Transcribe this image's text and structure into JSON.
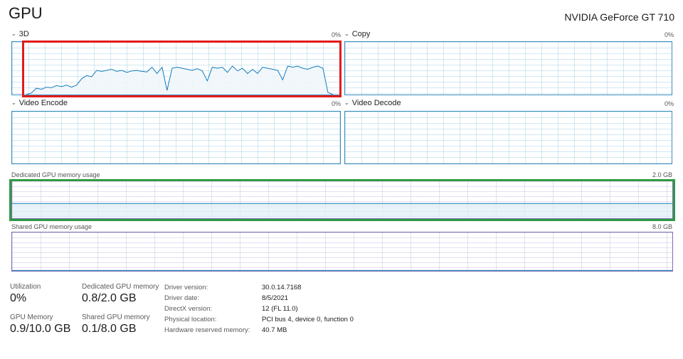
{
  "header": {
    "title": "GPU",
    "device": "NVIDIA GeForce GT 710"
  },
  "engines": [
    {
      "name": "3D",
      "percent": "0%",
      "samples": [
        0,
        3,
        12,
        10,
        14,
        13,
        17,
        15,
        18,
        14,
        18,
        30,
        36,
        34,
        46,
        44,
        46,
        48,
        44,
        46,
        42,
        45,
        46,
        44,
        43,
        52,
        40,
        52,
        8,
        50,
        52,
        50,
        48,
        46,
        49,
        45,
        26,
        52,
        50,
        52,
        42,
        54,
        45,
        50,
        40,
        48,
        40,
        52,
        50,
        48,
        46,
        28,
        54,
        52,
        54,
        50,
        48,
        52,
        54,
        50,
        4,
        0
      ]
    },
    {
      "name": "Copy",
      "percent": "0%",
      "samples": []
    },
    {
      "name": "Video Encode",
      "percent": "0%",
      "samples": []
    },
    {
      "name": "Video Decode",
      "percent": "0%",
      "samples": []
    }
  ],
  "dedicated_memory": {
    "label": "Dedicated GPU memory usage",
    "max": "2.0 GB",
    "fraction": 0.4
  },
  "shared_memory": {
    "label": "Shared GPU memory usage",
    "max": "8.0 GB",
    "fraction": 0.0125
  },
  "stats": {
    "utilization": {
      "label": "Utilization",
      "value": "0%"
    },
    "dedicated": {
      "label": "Dedicated GPU memory",
      "value": "0.8/2.0 GB"
    },
    "gpu_memory": {
      "label": "GPU Memory",
      "value": "0.9/10.0 GB"
    },
    "shared": {
      "label": "Shared GPU memory",
      "value": "0.1/8.0 GB"
    }
  },
  "properties": [
    {
      "key": "Driver version:",
      "value": "30.0.14.7168"
    },
    {
      "key": "Driver date:",
      "value": "8/5/2021"
    },
    {
      "key": "DirectX version:",
      "value": "12 (FL 11.0)"
    },
    {
      "key": "Physical location:",
      "value": "PCI bus 4, device 0, function 0"
    },
    {
      "key": "Hardware reserved memory:",
      "value": "40.7 MB"
    }
  ],
  "colors": {
    "line": "#117dbb",
    "fill": "#f1f6fb",
    "highlight_red": "#e21b1b",
    "highlight_green": "#2f9a42",
    "memory_border": "#7b6fb3"
  }
}
